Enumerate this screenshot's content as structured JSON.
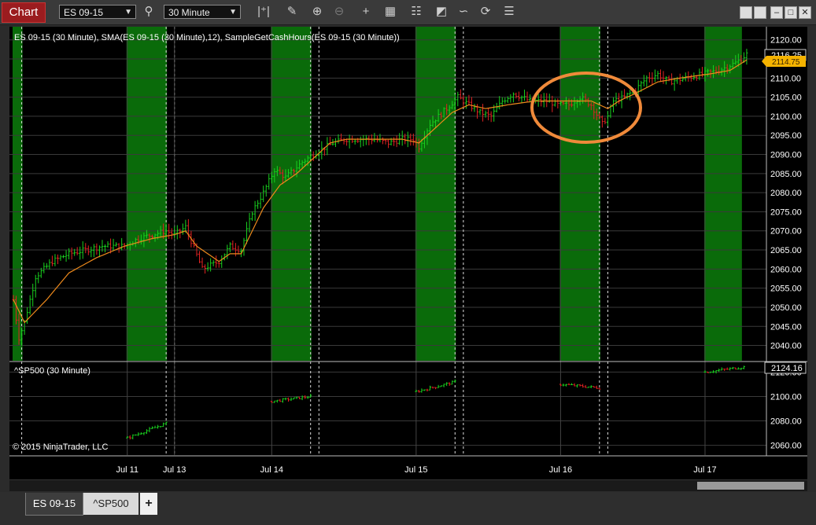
{
  "toolbar": {
    "chart_label": "Chart",
    "instrument": "ES 09-15",
    "interval": "30 Minute",
    "icons": [
      "search-icon",
      "bar-type-icon",
      "pencil-draw-icon",
      "zoom-in-icon",
      "zoom-out-icon",
      "crosshair-icon",
      "data-box-icon",
      "properties-icon",
      "strategies-icon",
      "indicators-icon",
      "reload-icon",
      "list-icon"
    ],
    "window_buttons": [
      "restore",
      "restore",
      "minimize",
      "maximize",
      "close"
    ]
  },
  "colors": {
    "session_fill": "#0a6b0a",
    "up_bar": "#19d11f",
    "down_bar": "#e02222",
    "sma_line": "#ee8a1c",
    "annotation": "#f08a3a",
    "last_price_bg": "#f5b300"
  },
  "top_panel": {
    "title": "ES 09-15 (30 Minute), SMA(ES 09-15 (30 Minute),12), SampleGetCashHours(ES 09-15 (30 Minute))",
    "last_price": "2116.25",
    "sma_value": "2114.75"
  },
  "bottom_panel": {
    "title": "^SP500 (30 Minute)",
    "last_price": "2124.16",
    "copyright": "© 2015 NinjaTrader, LLC"
  },
  "x_axis": {
    "labels": [
      "Jul 11",
      "Jul 13",
      "Jul 14",
      "Jul 15",
      "Jul 16",
      "Jul 17"
    ]
  },
  "tabs": {
    "items": [
      "ES 09-15",
      "^SP500"
    ],
    "add_label": "+"
  },
  "chart_data": [
    {
      "type": "ohlc",
      "title": "ES 09-15 (30 Minute)",
      "series": [
        {
          "name": "ES 09-15 (30 Minute)"
        },
        {
          "name": "SMA(ES 09-15 (30 Minute),12)"
        },
        {
          "name": "SampleGetCashHours(ES 09-15 (30 Minute))"
        }
      ],
      "ylim": [
        2036.0,
        2122.0
      ],
      "y_ticks": [
        2040,
        2045,
        2050,
        2055,
        2060,
        2065,
        2070,
        2075,
        2080,
        2085,
        2090,
        2095,
        2100,
        2105,
        2110,
        2115,
        2120
      ],
      "y_tick_labels": [
        "2040.00",
        "2045.00",
        "2050.00",
        "2055.00",
        "2060.00",
        "2065.00",
        "2070.00",
        "2075.00",
        "2080.00",
        "2085.00",
        "2090.00",
        "2095.00",
        "2100.00",
        "2105.00",
        "2110.00",
        "2115.00",
        "2120.00"
      ],
      "close_path": [
        [
          0,
          2052
        ],
        [
          2,
          2042
        ],
        [
          4,
          2046
        ],
        [
          8,
          2058
        ],
        [
          14,
          2062
        ],
        [
          20,
          2064
        ],
        [
          26,
          2065
        ],
        [
          32,
          2066
        ],
        [
          40,
          2066
        ],
        [
          45,
          2068
        ],
        [
          50,
          2069
        ],
        [
          55,
          2070
        ],
        [
          58,
          2069
        ],
        [
          62,
          2071
        ],
        [
          68,
          2060
        ],
        [
          74,
          2062
        ],
        [
          78,
          2066
        ],
        [
          82,
          2065
        ],
        [
          86,
          2075
        ],
        [
          90,
          2080
        ],
        [
          94,
          2086
        ],
        [
          98,
          2084
        ],
        [
          104,
          2088
        ],
        [
          110,
          2091
        ],
        [
          115,
          2093
        ],
        [
          120,
          2094
        ],
        [
          125,
          2094
        ],
        [
          130,
          2094
        ],
        [
          135,
          2093
        ],
        [
          140,
          2094
        ],
        [
          144,
          2094
        ],
        [
          146,
          2092
        ],
        [
          150,
          2098
        ],
        [
          156,
          2102
        ],
        [
          160,
          2105
        ],
        [
          164,
          2103
        ],
        [
          168,
          2101
        ],
        [
          172,
          2100
        ],
        [
          176,
          2104
        ],
        [
          180,
          2106
        ],
        [
          186,
          2104
        ],
        [
          192,
          2104
        ],
        [
          196,
          2103
        ],
        [
          200,
          2103
        ],
        [
          204,
          2105
        ],
        [
          208,
          2103
        ],
        [
          212,
          2098
        ],
        [
          214,
          2100
        ],
        [
          216,
          2104
        ],
        [
          220,
          2105
        ],
        [
          224,
          2107
        ],
        [
          228,
          2110
        ],
        [
          232,
          2111
        ],
        [
          236,
          2109
        ],
        [
          242,
          2110
        ],
        [
          248,
          2111
        ],
        [
          254,
          2112
        ],
        [
          260,
          2114
        ],
        [
          264,
          2116.25
        ]
      ],
      "sma_path": [
        [
          0,
          2052
        ],
        [
          4,
          2046
        ],
        [
          12,
          2052
        ],
        [
          20,
          2059
        ],
        [
          30,
          2063
        ],
        [
          40,
          2066
        ],
        [
          50,
          2068
        ],
        [
          58,
          2069
        ],
        [
          62,
          2070
        ],
        [
          66,
          2066
        ],
        [
          70,
          2064
        ],
        [
          74,
          2062
        ],
        [
          78,
          2064
        ],
        [
          82,
          2064
        ],
        [
          86,
          2070
        ],
        [
          90,
          2076
        ],
        [
          96,
          2082
        ],
        [
          102,
          2085
        ],
        [
          108,
          2089
        ],
        [
          114,
          2093
        ],
        [
          120,
          2094
        ],
        [
          130,
          2094
        ],
        [
          140,
          2094
        ],
        [
          146,
          2093
        ],
        [
          152,
          2097
        ],
        [
          158,
          2101
        ],
        [
          164,
          2103
        ],
        [
          170,
          2102
        ],
        [
          178,
          2103
        ],
        [
          188,
          2104
        ],
        [
          200,
          2104
        ],
        [
          208,
          2104
        ],
        [
          214,
          2102
        ],
        [
          218,
          2104
        ],
        [
          224,
          2106
        ],
        [
          232,
          2109
        ],
        [
          240,
          2110
        ],
        [
          250,
          2111
        ],
        [
          258,
          2112
        ],
        [
          264,
          2114.75
        ]
      ]
    },
    {
      "type": "ohlc",
      "title": "^SP500 (30 Minute)",
      "series": [
        {
          "name": "^SP500 (30 Minute)"
        }
      ],
      "ylim": [
        2052.0,
        2128.0
      ],
      "y_ticks": [
        2060,
        2080,
        2100,
        2120
      ],
      "y_tick_labels": [
        "2060.00",
        "2080.00",
        "2100.00",
        "2120.00"
      ],
      "sessions": [
        {
          "start": 41,
          "end": 55,
          "from": 2066,
          "to": 2078
        },
        {
          "start": 93,
          "end": 107,
          "from": 2096,
          "to": 2100
        },
        {
          "start": 145,
          "end": 159,
          "from": 2104,
          "to": 2112
        },
        {
          "start": 197,
          "end": 211,
          "from": 2110,
          "to": 2107
        },
        {
          "start": 249,
          "end": 263,
          "from": 2120,
          "to": 2124.16
        }
      ]
    }
  ]
}
